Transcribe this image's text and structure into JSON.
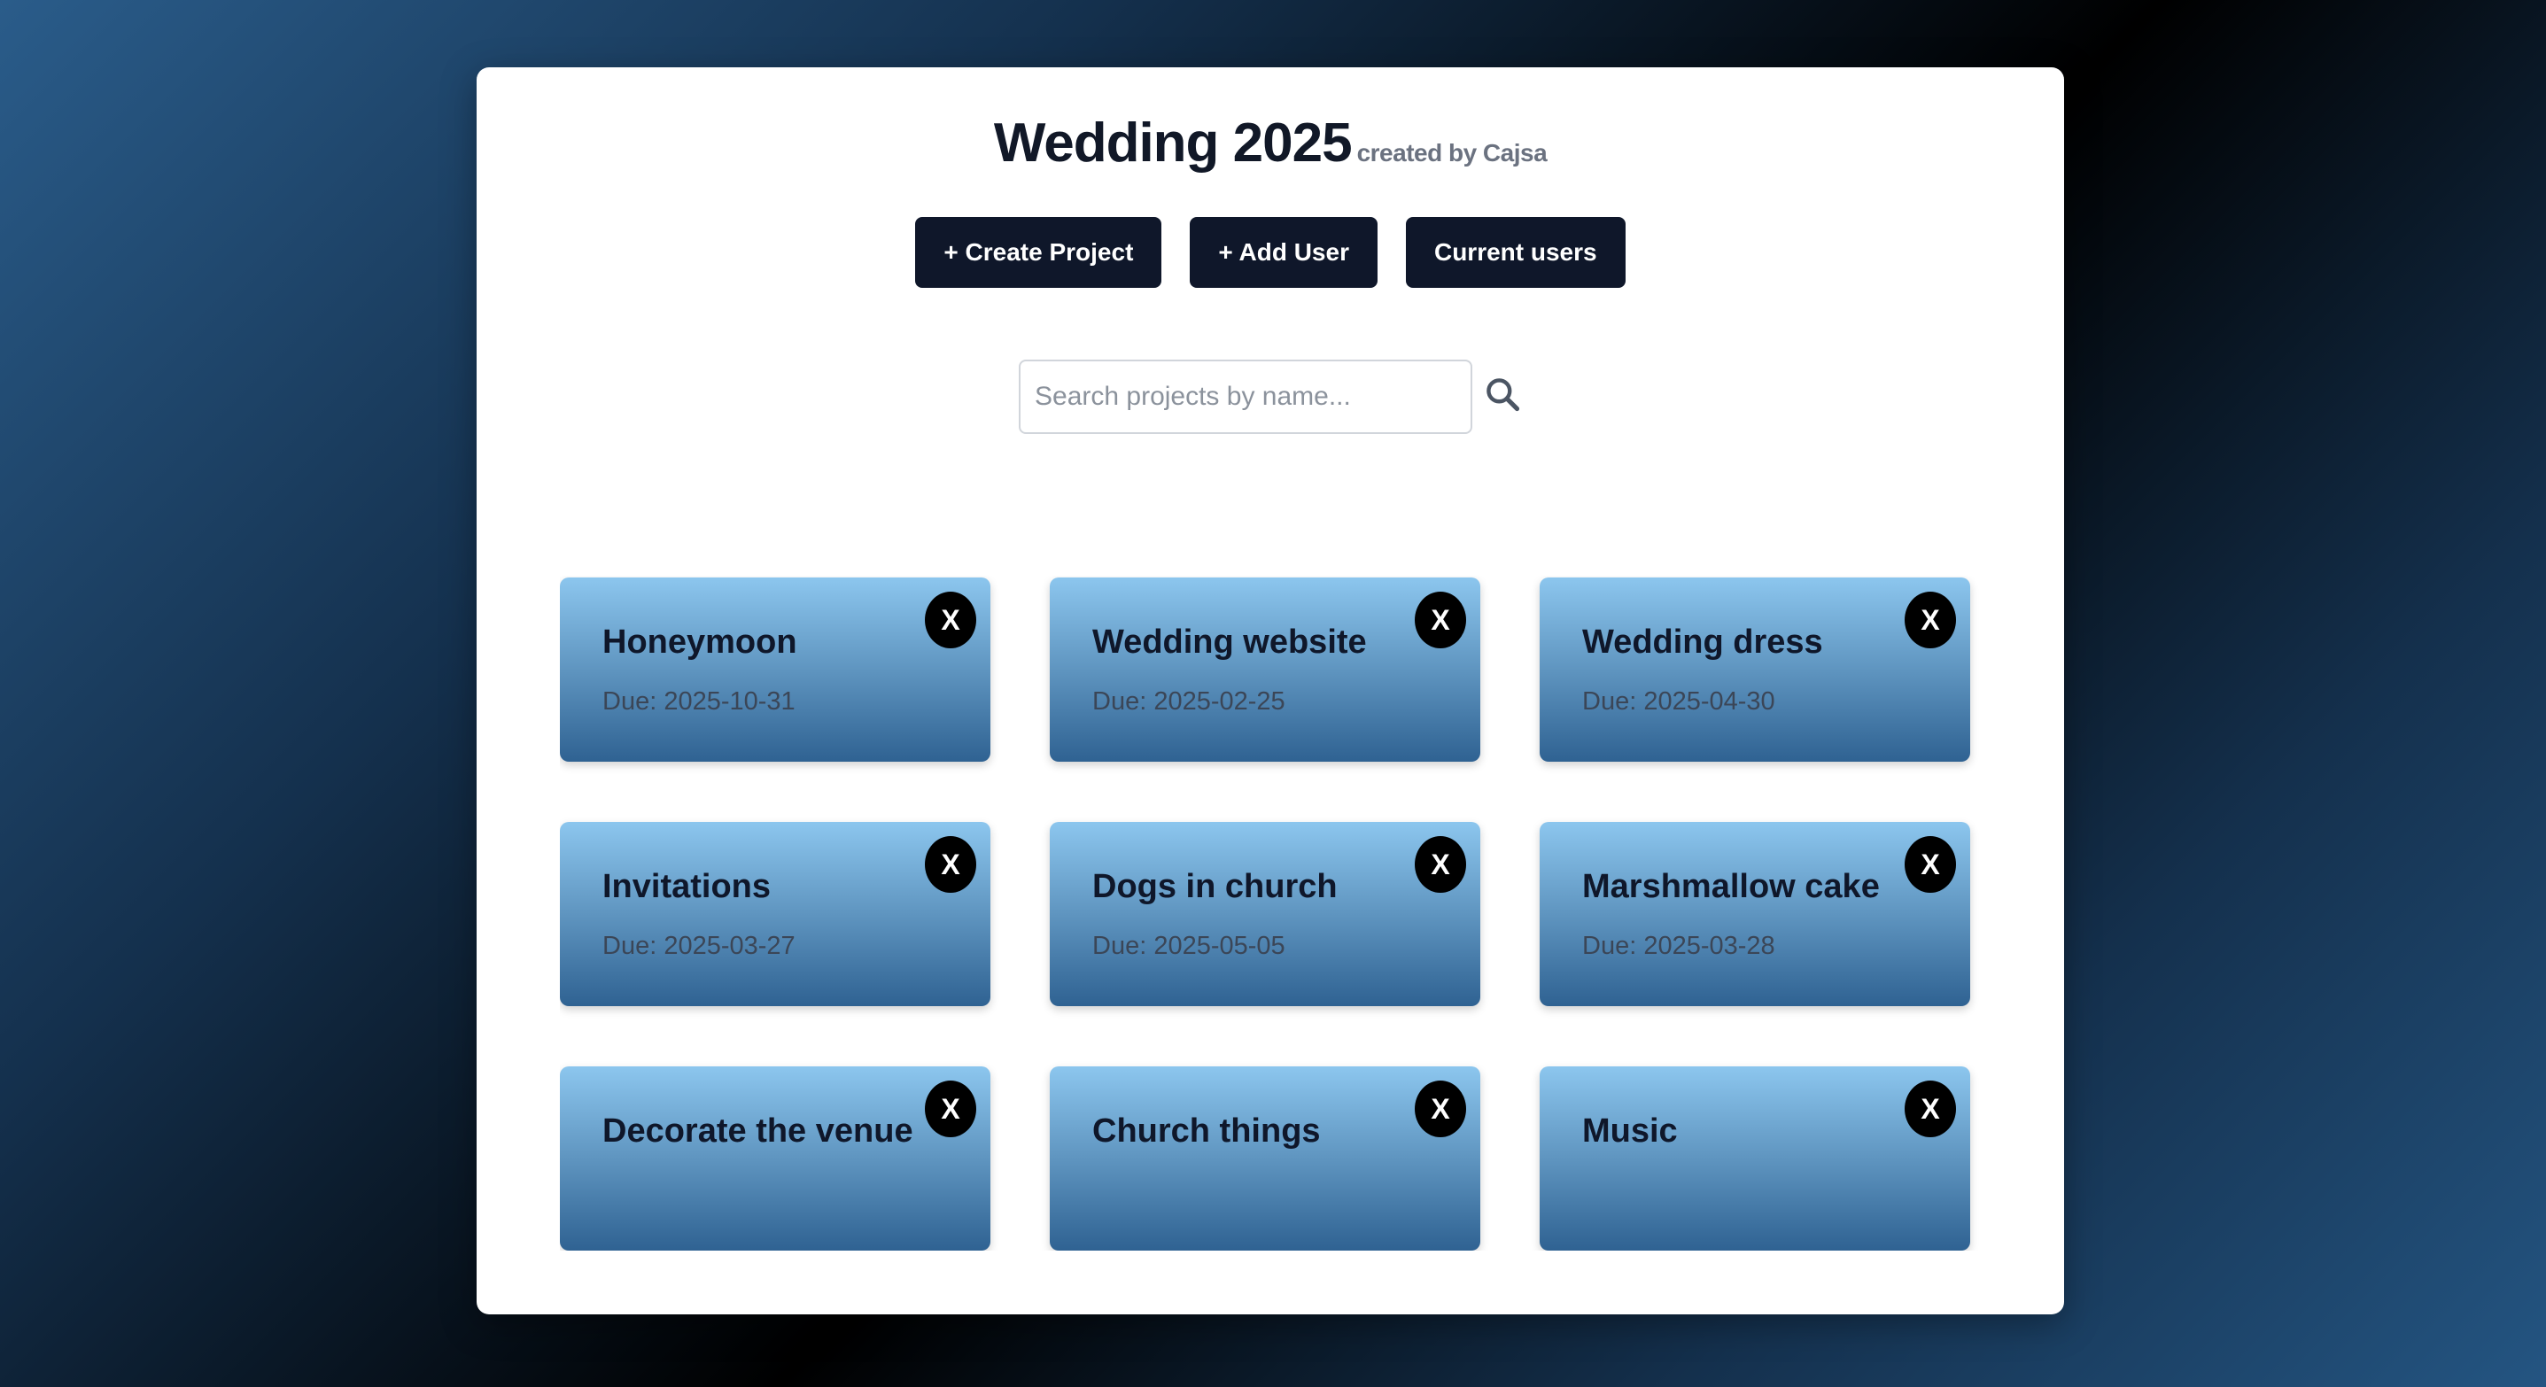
{
  "header": {
    "title": "Wedding 2025",
    "subtitle": "created by Cajsa"
  },
  "actions": {
    "create_project": "+ Create Project",
    "add_user": "+ Add User",
    "current_users": "Current users"
  },
  "search": {
    "placeholder": "Search projects by name...",
    "value": "",
    "icon": "search-icon"
  },
  "projects": [
    {
      "name": "Honeymoon",
      "due": "Due: 2025-10-31",
      "close": "X"
    },
    {
      "name": "Wedding website",
      "due": "Due: 2025-02-25",
      "close": "X"
    },
    {
      "name": "Wedding dress",
      "due": "Due: 2025-04-30",
      "close": "X"
    },
    {
      "name": "Invitations",
      "due": "Due: 2025-03-27",
      "close": "X"
    },
    {
      "name": "Dogs in church",
      "due": "Due: 2025-05-05",
      "close": "X"
    },
    {
      "name": "Marshmallow cake",
      "due": "Due: 2025-03-28",
      "close": "X"
    },
    {
      "name": "Decorate the venue",
      "due": "",
      "close": "X"
    },
    {
      "name": "Church things",
      "due": "",
      "close": "X"
    },
    {
      "name": "Music",
      "due": "",
      "close": "X"
    }
  ],
  "colors": {
    "button_bg": "#0f172a",
    "card_gradient_top": "#8cc6ee",
    "card_gradient_bottom": "#2f6292",
    "close_bg": "#000000"
  }
}
